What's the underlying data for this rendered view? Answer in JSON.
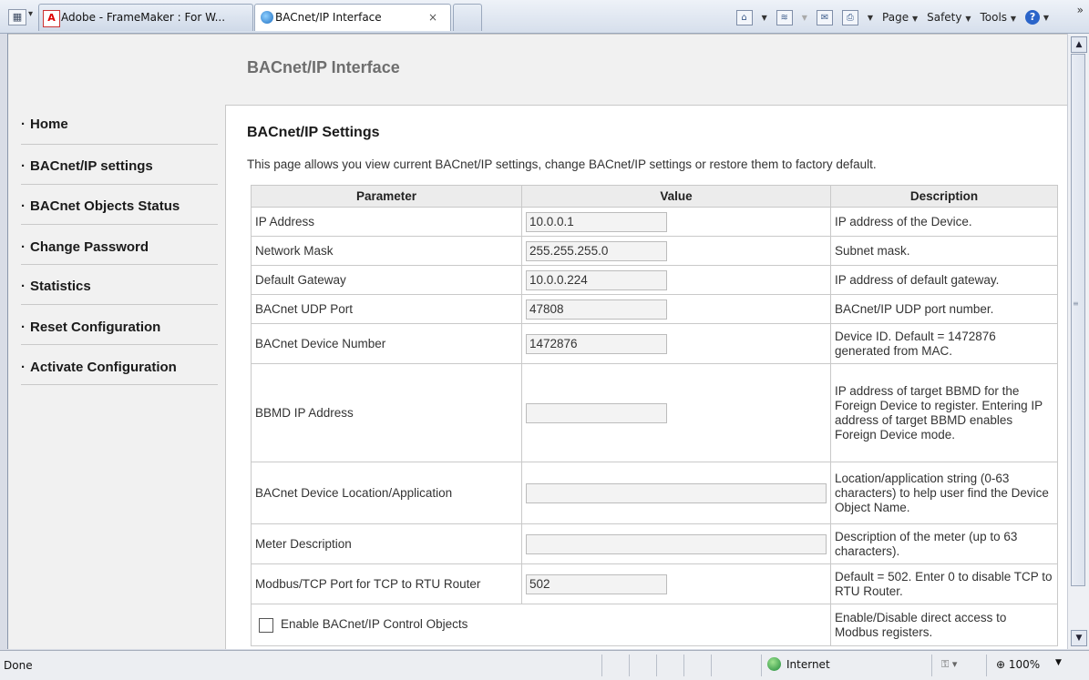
{
  "browser": {
    "quick_tabs_icon": "quick-tabs-icon",
    "tabs": [
      {
        "label": "Adobe - FrameMaker : For W..."
      },
      {
        "label": "BACnet/IP Interface",
        "close": "×"
      }
    ],
    "toolbar": {
      "page": "Page",
      "safety": "Safety",
      "tools": "Tools",
      "overflow": "»"
    }
  },
  "page": {
    "header_title": "BACnet/IP Interface",
    "nav": [
      {
        "label": "Home"
      },
      {
        "label": "BACnet/IP settings"
      },
      {
        "label": "BACnet Objects Status"
      },
      {
        "label": "Change Password"
      },
      {
        "label": "Statistics"
      },
      {
        "label": "Reset Configuration"
      },
      {
        "label": "Activate Configuration"
      }
    ],
    "section_title": "BACnet/IP Settings",
    "intro": "This page allows you view current BACnet/IP settings, change BACnet/IP settings or restore them to factory default.",
    "table": {
      "headers": [
        "Parameter",
        "Value",
        "Description"
      ],
      "rows": [
        {
          "param": "IP Address",
          "value": "10.0.0.1",
          "desc": "IP address of the Device."
        },
        {
          "param": "Network Mask",
          "value": "255.255.255.0",
          "desc": "Subnet mask."
        },
        {
          "param": "Default Gateway",
          "value": "10.0.0.224",
          "desc": "IP address of default gateway."
        },
        {
          "param": "BACnet UDP Port",
          "value": "47808",
          "desc": "BACnet/IP UDP port number."
        },
        {
          "param": "BACnet Device Number",
          "value": "1472876",
          "desc": "Device ID. Default = 1472876 generated from MAC."
        },
        {
          "param": "BBMD IP Address",
          "value": "",
          "desc": "IP address of target BBMD for the Foreign Device to register. Entering IP address of target BBMD enables Foreign Device mode."
        },
        {
          "param": "BACnet Device Location/Application",
          "value": "",
          "desc": "Location/application string (0-63 characters) to help user find the Device Object Name."
        },
        {
          "param": "Meter Description",
          "value": "",
          "desc": "Description of the meter (up to 63 characters)."
        },
        {
          "param": "Modbus/TCP Port for TCP to RTU Router",
          "value": "502",
          "desc": "Default = 502. Enter 0 to disable TCP to RTU Router."
        },
        {
          "param": "Enable BACnet/IP Control Objects",
          "checked": false,
          "desc": "Enable/Disable direct access to Modbus registers."
        }
      ]
    }
  },
  "statusbar": {
    "left": "Done",
    "zone": "Internet",
    "zoom": "100%"
  }
}
